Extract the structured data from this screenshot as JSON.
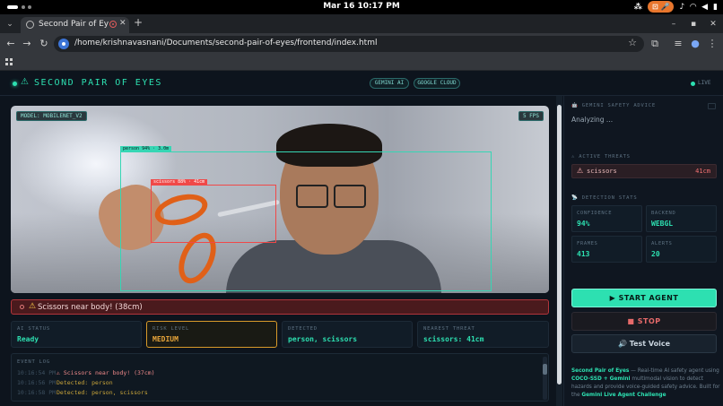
{
  "os": {
    "clock": "Mar 16  10:17 PM",
    "tray_badge": "⊡ 🎤"
  },
  "browser": {
    "tab_title": "Second Pair of Eyes",
    "url": "/home/krishnavasnani/Documents/second-pair-of-eyes/frontend/index.html"
  },
  "app": {
    "title": "SECOND PAIR OF EYES",
    "badges": [
      "GEMINI AI",
      "GOOGLE CLOUD"
    ],
    "live": "LIVE",
    "accent": "#2de0b1",
    "danger": "#f04848"
  },
  "video": {
    "model_tag": "MODEL: MOBILENET_V2",
    "fps_tag": "5 FPS",
    "person_label": "person 94% · 3.0m",
    "scissors_label": "scissors 88% · 41cm"
  },
  "alert": {
    "text": "Scissors near body! (38cm)"
  },
  "stats": [
    {
      "label": "AI STATUS",
      "value": "Ready",
      "color": "#2de0b1"
    },
    {
      "label": "RISK LEVEL",
      "value": "MEDIUM",
      "color": "#e8a53a"
    },
    {
      "label": "DETECTED",
      "value": "person, scissors",
      "color": "#2de0b1"
    },
    {
      "label": "NEAREST THREAT",
      "value": "scissors: 41cm",
      "color": "#2de0b1"
    }
  ],
  "event_log": {
    "title": "EVENT LOG",
    "rows": [
      {
        "time": "10:16:54 PM",
        "msg": "⚠ Scissors near body! (37cm)"
      },
      {
        "time": "10:16:56 PM",
        "msg": "Detected: person"
      },
      {
        "time": "10:16:58 PM",
        "msg": "Detected: person, scissors"
      }
    ]
  },
  "sidebar": {
    "advice_title": "GEMINI SAFETY ADVICE",
    "advice_text": "Analyzing ...",
    "threats_title": "ACTIVE THREATS",
    "threat": {
      "name": "scissors",
      "distance": "41cm"
    },
    "stats_title": "DETECTION STATS",
    "detection_stats": [
      {
        "label": "CONFIDENCE",
        "value": "94%"
      },
      {
        "label": "BACKEND",
        "value": "WEBGL"
      },
      {
        "label": "FRAMES",
        "value": "413"
      },
      {
        "label": "ALERTS",
        "value": "20"
      }
    ],
    "start_label": "START AGENT",
    "stop_label": "STOP",
    "voice_label": "Test Voice",
    "footer": {
      "name": "Second Pair of Eyes",
      "p1": " — Real-time AI safety agent using ",
      "tech": "COCO-SSD + Gemini",
      "p2": " multimodal vision to detect hazards and provide voice-guided safety advice. Built for the ",
      "challenge": "Gemini Live Agent Challenge"
    }
  }
}
